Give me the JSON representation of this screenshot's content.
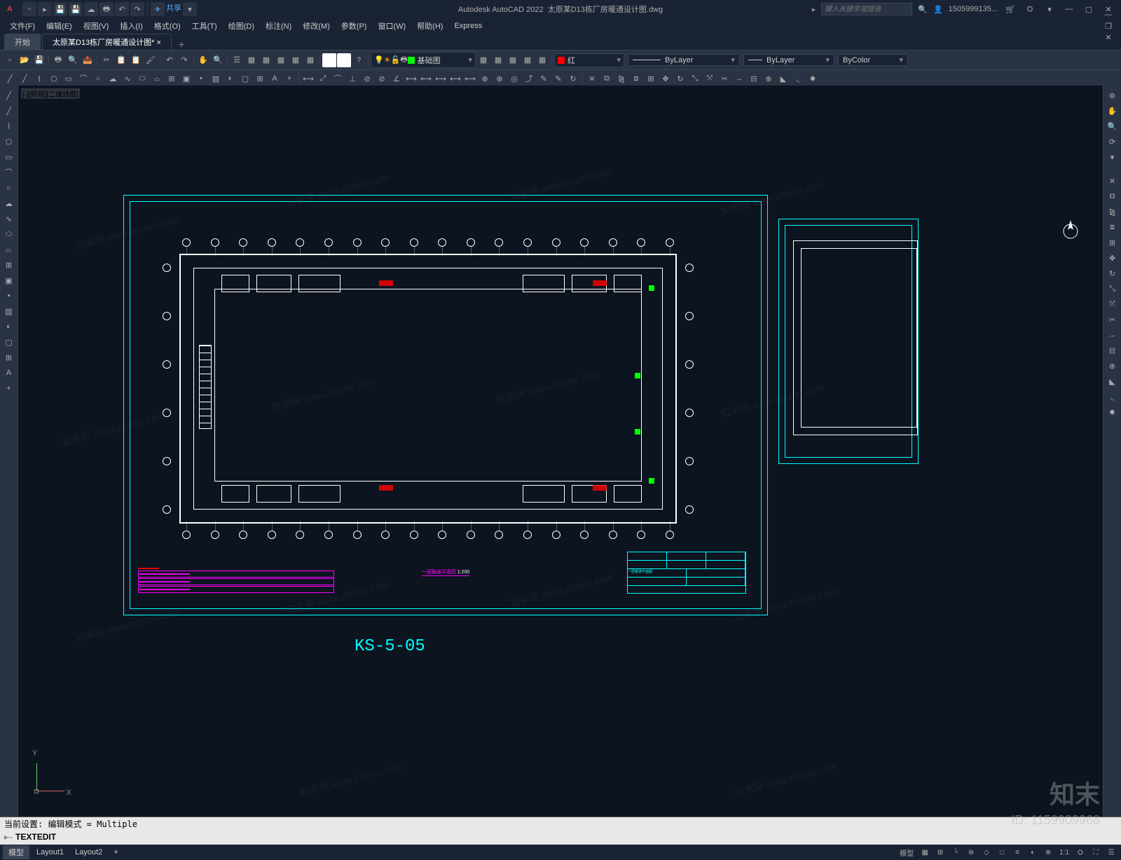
{
  "title": {
    "app": "Autodesk AutoCAD 2022",
    "file": "太原某D13栋厂房暖通设计图.dwg"
  },
  "search": {
    "placeholder": "鍵入关键字或短语"
  },
  "user": {
    "name": "1505999135..."
  },
  "menus": [
    "文件(F)",
    "编辑(E)",
    "视图(V)",
    "插入(I)",
    "格式(O)",
    "工具(T)",
    "绘图(D)",
    "标注(N)",
    "修改(M)",
    "参数(P)",
    "窗口(W)",
    "帮助(H)",
    "Express"
  ],
  "share": "共享",
  "tabs": {
    "start": "开始",
    "active": "太原某D13栋厂房暖通设计图*"
  },
  "layer": {
    "name": "基础图",
    "color_swatch": "#00ff00"
  },
  "color": {
    "name": "红",
    "swatch": "#ff0000"
  },
  "props": {
    "linetype": "ByLayer",
    "lineweight": "ByLayer",
    "plotstyle": "ByColor"
  },
  "viewport": {
    "label": "[-][俯视][二维线框]"
  },
  "drawing": {
    "sheet_label": "KS-5-05",
    "scale_text": "1:200",
    "plan_title": "一层暖通平面图"
  },
  "ucs": {
    "y": "Y",
    "x": "X"
  },
  "cmd": {
    "history": "当前设置: 编辑模式 = Multiple",
    "prompt": "TEXTEDIT"
  },
  "status": {
    "model": "模型",
    "layout1": "Layout1",
    "layout2": "Layout2",
    "model_btn": "模型",
    "scale": "1:1"
  },
  "watermark": {
    "text": "知末网 www.znzmo.com",
    "logo": "知末",
    "id": "ID: 1159909968"
  }
}
